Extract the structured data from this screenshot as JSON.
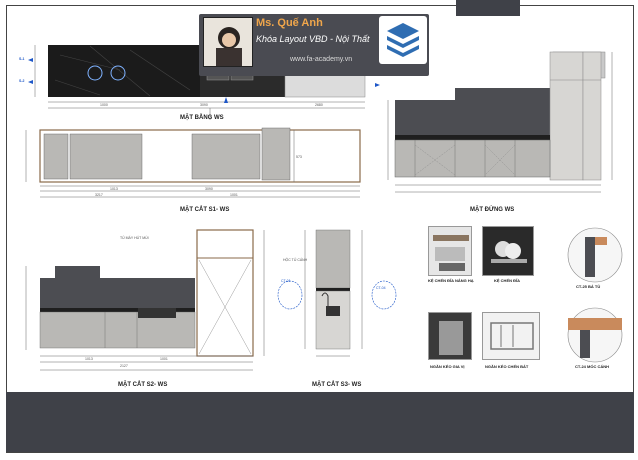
{
  "banner": {
    "name": "Ms. Quế Anh",
    "course": "Khóa Layout VBD - Nội Thất",
    "url": "www.fa-academy.vn"
  },
  "views": {
    "plan": {
      "title": "MẶT BẰNG WS",
      "cut_left_1": "S-1",
      "cut_left_2": "S-2",
      "dims": [
        "1000",
        "3090",
        "2680"
      ]
    },
    "section1": {
      "title": "MẶT CẮT S1- WS",
      "dims": [
        "3217",
        "3090",
        "1013",
        "1001",
        "573"
      ]
    },
    "elevation": {
      "title": "MẶT ĐỨNG WS"
    },
    "section2": {
      "title": "MẶT CẮT S2- WS",
      "note_top": "TỦ MÁY HÚT MÙI",
      "dims": [
        "2127",
        "1013",
        "1001"
      ]
    },
    "section3": {
      "title": "MẶT CẮT S3- WS",
      "note_top": "HỘC TỦ CÁNH",
      "ct01": "CT-01",
      "ct04": "CT-04"
    }
  },
  "catalog": {
    "items": [
      {
        "caption": "KỆ CHÉN ĐĨA NÂNG HẠ"
      },
      {
        "caption": "KỆ CHÉN ĐĨA"
      },
      {
        "caption": "CT-25 BÁ TỦ"
      },
      {
        "caption": "NGĂN KÉO GIA VỊ"
      },
      {
        "caption": "NGĂN KÉO CHÉN BÁT"
      },
      {
        "caption": "CT-24 MÓC CÁNH"
      }
    ]
  },
  "colors": {
    "cabinet_fill": "#b9b8b5",
    "countertop": "#1f1f1f",
    "upper_dark": "#4c4d52",
    "bar": "#3f4148",
    "accent": "#f0a64b",
    "logo_blue": "#2f6db2"
  }
}
